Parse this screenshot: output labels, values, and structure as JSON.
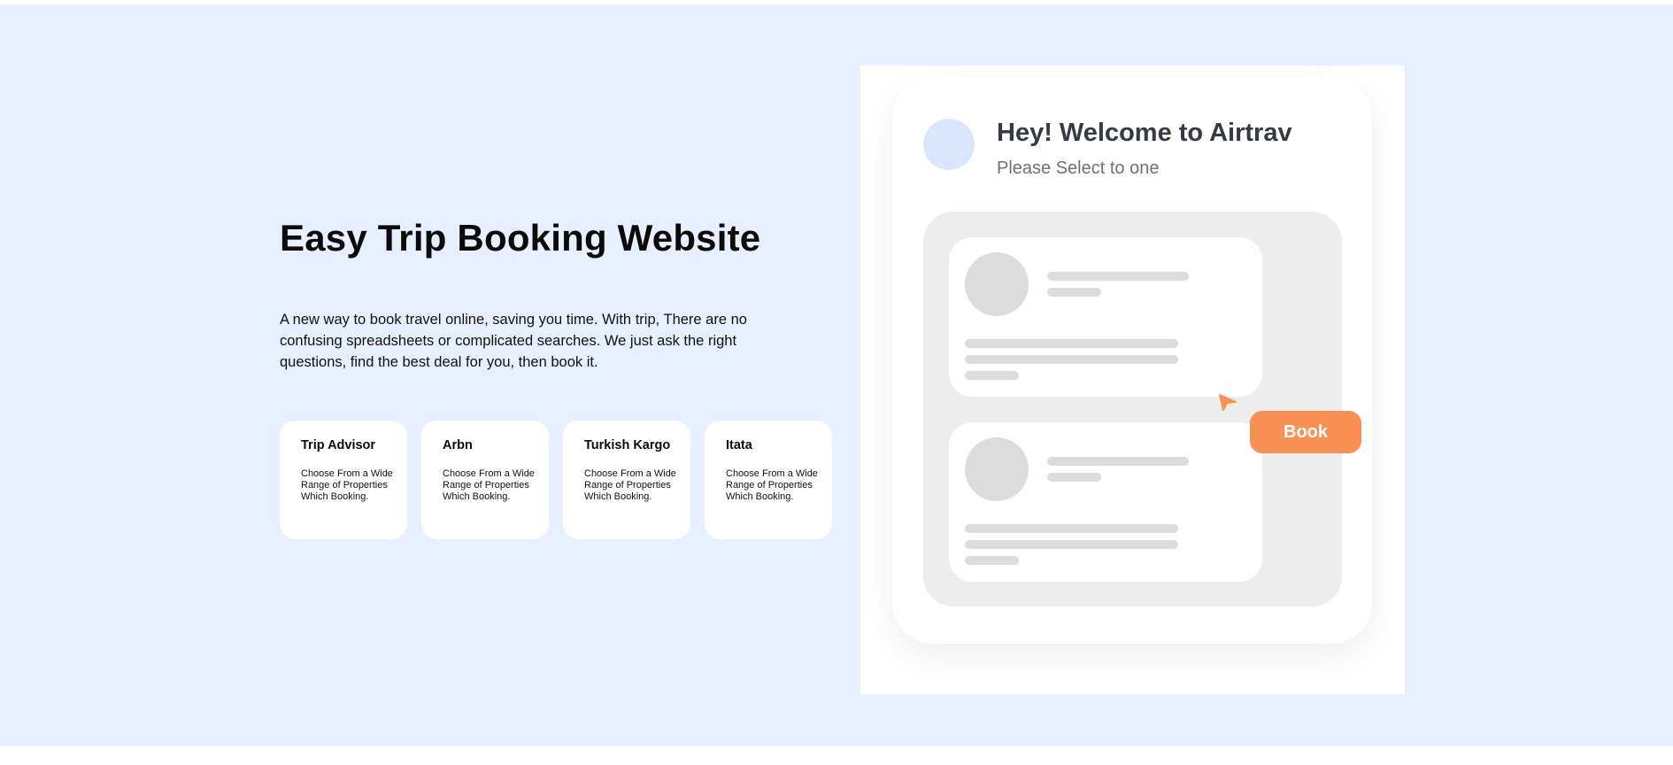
{
  "hero": {
    "title": "Easy Trip Booking Website",
    "description": "A new way to book travel online, saving you time. With trip, There are no confusing spreadsheets or complicated searches. We just ask the right questions, find the best deal for you, then book it."
  },
  "partners": [
    {
      "name": "Trip Advisor",
      "text": "Choose From a Wide Range of Properties Which Booking."
    },
    {
      "name": "Arbn",
      "text": "Choose From a Wide Range of Properties Which Booking."
    },
    {
      "name": "Turkish Kargo",
      "text": "Choose From a Wide Range of Properties Which Booking."
    },
    {
      "name": "Itata",
      "text": "Choose From a Wide Range of Properties Which Booking."
    }
  ],
  "mockup": {
    "welcome": "Hey! Welcome to Airtrav",
    "subtitle": "Please Select to one",
    "book_label": "Book",
    "icons": [
      "cursor-arrow-icon"
    ]
  },
  "colors": {
    "background": "#e8effe",
    "accent": "#fa9154",
    "avatar": "#dbe6fe",
    "placeholder": "#dcdcdc",
    "list_bg": "#ededed"
  }
}
